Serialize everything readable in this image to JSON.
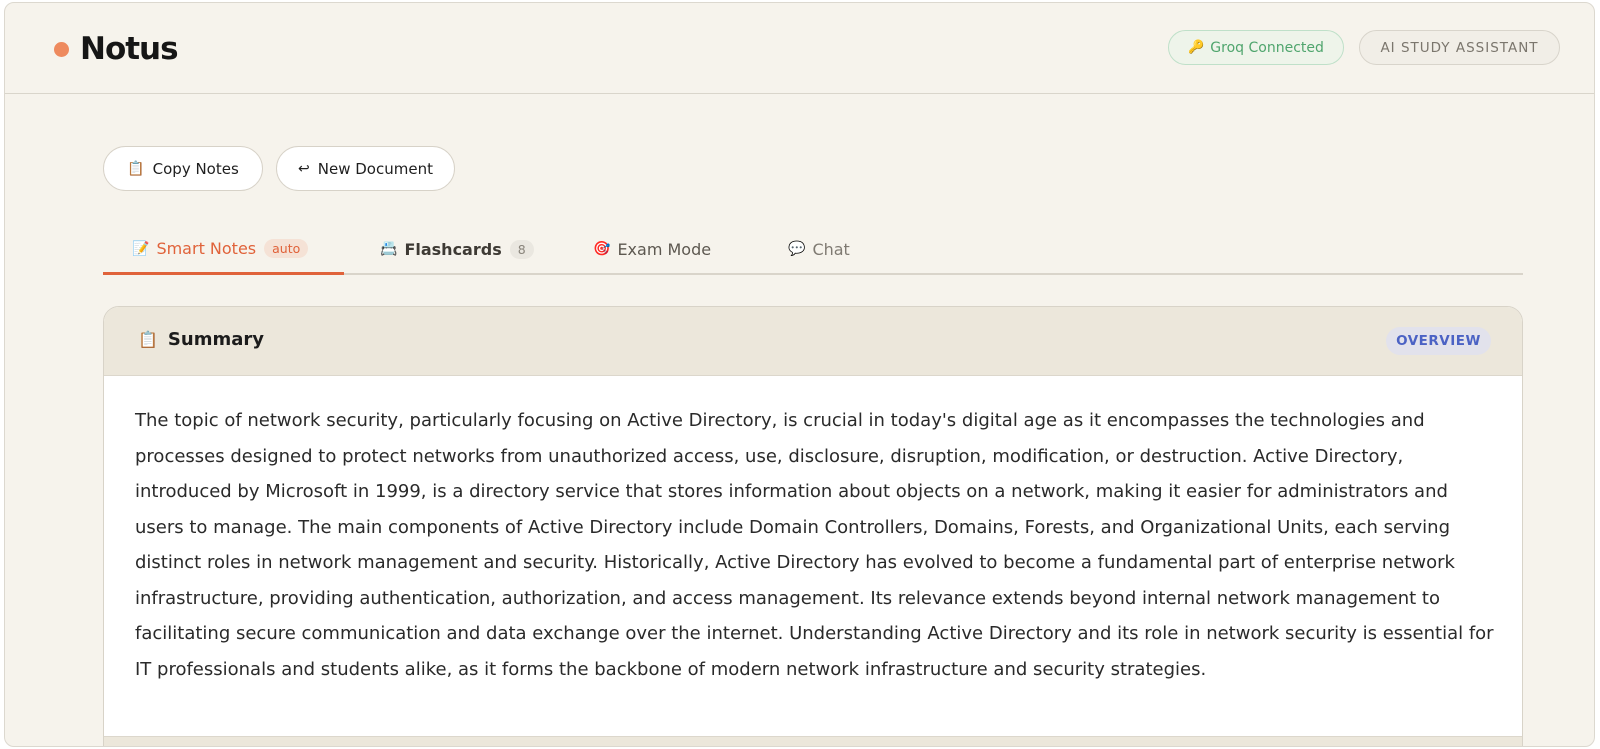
{
  "brand": {
    "name": "Notus",
    "dot_color": "#ee8a5e"
  },
  "header": {
    "groq_icon": "key-icon",
    "groq_label": "Groq Connected",
    "assistant_label": "AI STUDY ASSISTANT"
  },
  "toolbar": {
    "copy_icon": "clipboard-icon",
    "copy_label": "Copy Notes",
    "new_icon": "return-arrow-icon",
    "new_label": "New Document"
  },
  "tabs": [
    {
      "icon": "notepad-icon",
      "label": "Smart Notes",
      "badge": "auto",
      "active": true
    },
    {
      "icon": "cards-icon",
      "label": "Flashcards",
      "badge": "8",
      "active": false
    },
    {
      "icon": "target-icon",
      "label": "Exam Mode",
      "active": false
    },
    {
      "icon": "speech-bubble-icon",
      "label": "Chat",
      "active": false
    }
  ],
  "summary_card": {
    "icon": "clipboard-icon",
    "title": "Summary",
    "tag": "OVERVIEW",
    "text": "The topic of network security, particularly focusing on Active Directory, is crucial in today's digital age as it encompasses the technologies and processes designed to protect networks from unauthorized access, use, disclosure, disruption, modification, or destruction. Active Directory, introduced by Microsoft in 1999, is a directory service that stores information about objects on a network, making it easier for administrators and users to manage. The main components of Active Directory include Domain Controllers, Domains, Forests, and Organizational Units, each serving distinct roles in network management and security. Historically, Active Directory has evolved to become a fundamental part of enterprise network infrastructure, providing authentication, authorization, and access management. Its relevance extends beyond internal network management to facilitating secure communication and data exchange over the internet. Understanding Active Directory and its role in network security is essential for IT professionals and students alike, as it forms the backbone of modern network infrastructure and security strategies."
  },
  "colors": {
    "accent": "#e0623a",
    "overview": "#4b62c4",
    "groq": "#4fa56d"
  }
}
